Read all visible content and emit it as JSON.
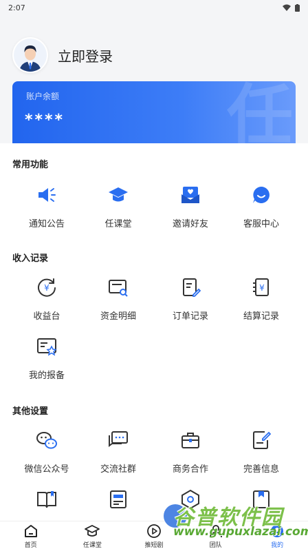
{
  "status_bar": {
    "time": "2:07"
  },
  "header": {
    "login_label": "立即登录"
  },
  "balance": {
    "label": "账户余额",
    "value": "****",
    "watermark": "任"
  },
  "sections": {
    "common": {
      "title": "常用功能",
      "items": [
        "通知公告",
        "任课堂",
        "邀请好友",
        "客服中心"
      ]
    },
    "income": {
      "title": "收入记录",
      "items": [
        "收益台",
        "资金明细",
        "订单记录",
        "结算记录",
        "我的报备"
      ]
    },
    "other": {
      "title": "其他设置",
      "items": [
        "微信公众号",
        "交流社群",
        "商务合作",
        "完善信息"
      ]
    }
  },
  "tabbar": {
    "items": [
      "首页",
      "任课堂",
      "推短剧",
      "团队",
      "我的"
    ]
  },
  "watermark": {
    "line1": "谷普软件园",
    "line2": "www.gupuxlazai.com"
  },
  "colors": {
    "accent": "#2a6ef0",
    "card_start": "#2265ee",
    "card_end": "#6a9bfb"
  }
}
